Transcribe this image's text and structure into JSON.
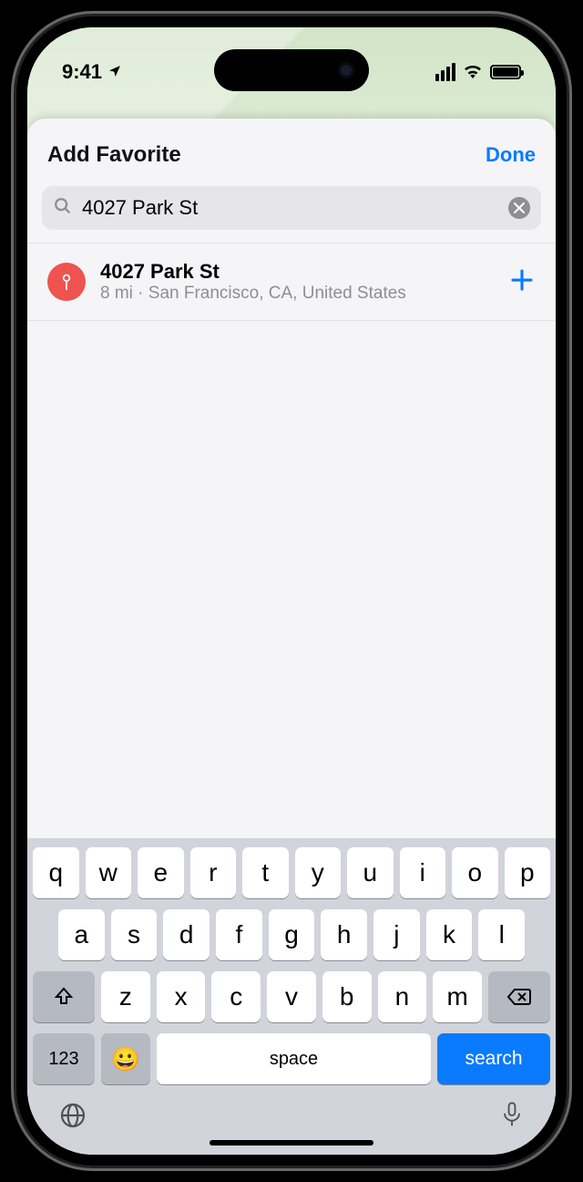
{
  "status": {
    "time": "9:41"
  },
  "sheet": {
    "title": "Add Favorite",
    "done_label": "Done"
  },
  "search": {
    "value": "4027 Park St"
  },
  "results": [
    {
      "title": "4027 Park St",
      "subtitle": "8 mi · San Francisco, CA, United States"
    }
  ],
  "keyboard": {
    "row1": [
      "q",
      "w",
      "e",
      "r",
      "t",
      "y",
      "u",
      "i",
      "o",
      "p"
    ],
    "row2": [
      "a",
      "s",
      "d",
      "f",
      "g",
      "h",
      "j",
      "k",
      "l"
    ],
    "row3": [
      "z",
      "x",
      "c",
      "v",
      "b",
      "n",
      "m"
    ],
    "numbers_label": "123",
    "space_label": "space",
    "action_label": "search"
  }
}
